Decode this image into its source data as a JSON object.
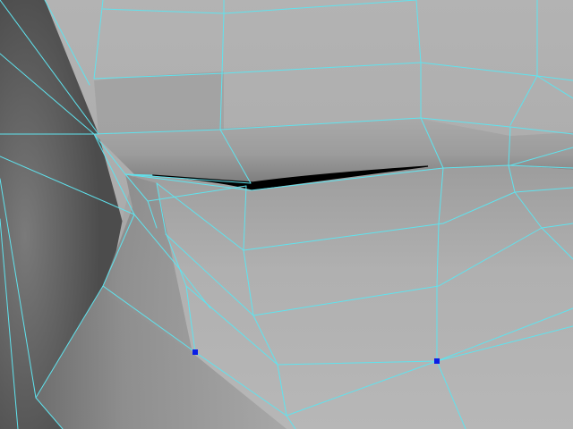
{
  "viewport": {
    "view": "perspective",
    "display_mode": "smooth-shaded-with-wireframe",
    "colors": {
      "wireframe": "#5fe3ee",
      "selected_vertex": "#0a1ee6",
      "mouth_gap": "#000000",
      "surface_light": "#b4b4b4",
      "surface_mid": "#9a9a9a",
      "surface_dark": "#6c6c6c"
    },
    "selected_vertex_count": 2
  }
}
